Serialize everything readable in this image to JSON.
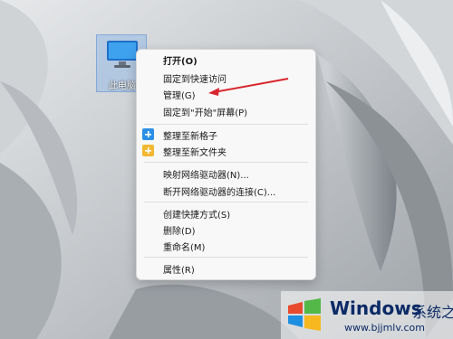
{
  "desktop": {
    "icon_label": "此电脑"
  },
  "context_menu": {
    "items": [
      {
        "label": "打开(O)"
      },
      {
        "label": "固定到快速访问"
      },
      {
        "label": "管理(G)"
      },
      {
        "label": "固定到\"开始\"屏幕(P)"
      },
      {
        "label": "整理至新格子",
        "icon": "plus-tile-icon"
      },
      {
        "label": "整理至新文件夹",
        "icon": "folder-icon"
      },
      {
        "label": "映射网络驱动器(N)..."
      },
      {
        "label": "断开网络驱动器的连接(C)..."
      },
      {
        "label": "创建快捷方式(S)"
      },
      {
        "label": "删除(D)"
      },
      {
        "label": "重命名(M)"
      },
      {
        "label": "属性(R)"
      }
    ]
  },
  "annotation": {
    "color": "#d8262e"
  },
  "watermark": {
    "brand": "Windows",
    "brand_suffix": "系统之家",
    "url": "www.bjjmlv.com"
  },
  "colors": {
    "menu_bg": "#f8f8f8",
    "selection": "#99c0ec",
    "tile_blue": "#2c8fe6",
    "folder_yellow": "#f2b832"
  }
}
